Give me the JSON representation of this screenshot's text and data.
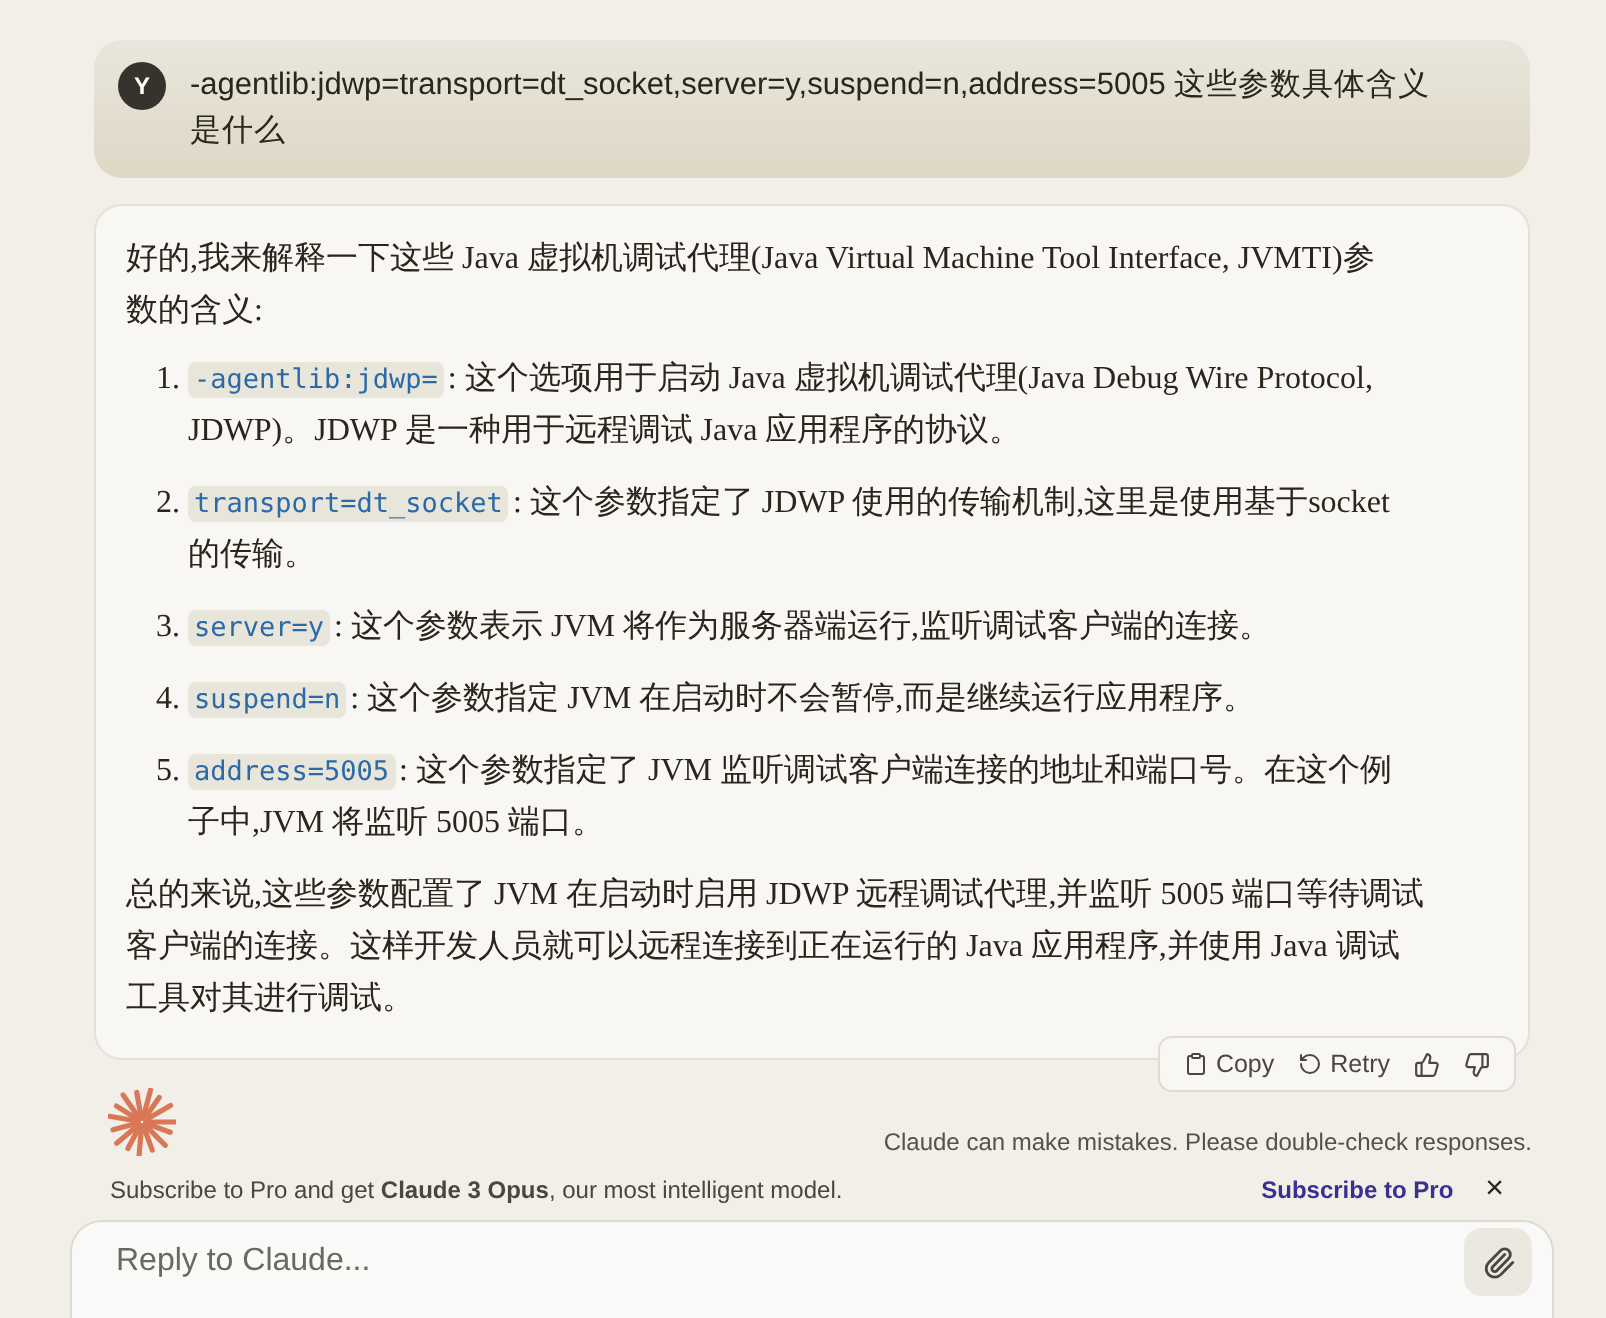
{
  "user_message": {
    "avatar": "Y",
    "text": "-agentlib:jdwp=transport=dt_socket,server=y,suspend=n,address=5005 这些参数具体含义是什么"
  },
  "response": {
    "intro": "好的,我来解释一下这些 Java 虚拟机调试代理(Java Virtual Machine Tool Interface, JVMTI)参数的含义:",
    "items": [
      {
        "number": "1.",
        "code": "-agentlib:jdwp=",
        "text": ": 这个选项用于启动 Java 虚拟机调试代理(Java Debug Wire Protocol, JDWP)。JDWP 是一种用于远程调试 Java 应用程序的协议。"
      },
      {
        "number": "2.",
        "code": "transport=dt_socket",
        "text": ": 这个参数指定了 JDWP 使用的传输机制,这里是使用基于socket 的传输。"
      },
      {
        "number": "3.",
        "code": "server=y",
        "text": ": 这个参数表示 JVM 将作为服务器端运行,监听调试客户端的连接。"
      },
      {
        "number": "4.",
        "code": "suspend=n",
        "text": ": 这个参数指定 JVM 在启动时不会暂停,而是继续运行应用程序。"
      },
      {
        "number": "5.",
        "code": "address=5005",
        "text": ": 这个参数指定了 JVM 监听调试客户端连接的地址和端口号。在这个例子中,JVM 将监听 5005 端口。"
      }
    ],
    "conclusion": "总的来说,这些参数配置了 JVM 在启动时启用 JDWP 远程调试代理,并监听 5005 端口等待调试客户端的连接。这样开发人员就可以远程连接到正在运行的 Java 应用程序,并使用 Java 调试工具对其进行调试。"
  },
  "actions": [
    {
      "kind": "copy",
      "label": "Copy"
    },
    {
      "kind": "retry",
      "label": "Retry"
    },
    {
      "kind": "thumbs-up"
    },
    {
      "kind": "thumbs-down"
    }
  ],
  "disclaimer": "Claude can make mistakes. Please double-check responses.",
  "banner": {
    "text": "Subscribe to Pro and get **Claude 3 Opus**, our most intelligent model.",
    "link": "Subscribe to Pro",
    "close": "×"
  },
  "composer": {
    "placeholder": "Reply to Claude..."
  }
}
